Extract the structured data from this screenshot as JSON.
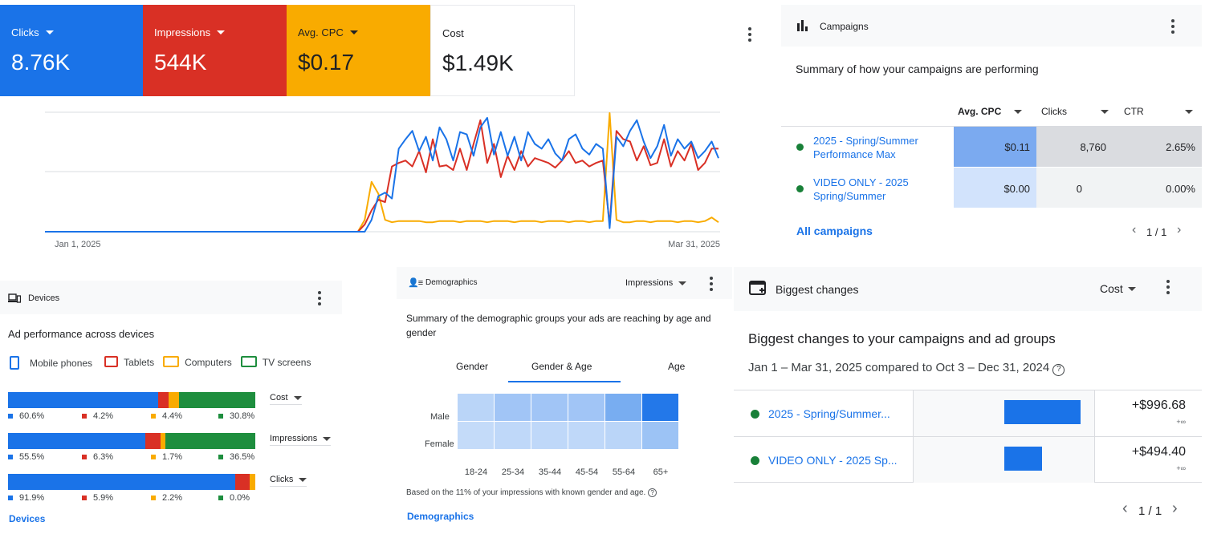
{
  "colors": {
    "blue": "#1a73e8",
    "red": "#d93025",
    "yellow": "#f9ab00",
    "green": "#1e8e3e",
    "navy": "#1967d2"
  },
  "metrics": [
    {
      "label": "Clicks",
      "value": "8.76K",
      "color": "#1a73e8",
      "dropdown": true
    },
    {
      "label": "Impressions",
      "value": "544K",
      "color": "#d93025",
      "dropdown": true
    },
    {
      "label": "Avg. CPC",
      "value": "$0.17",
      "color": "#f9ab00",
      "dropdown": true
    },
    {
      "label": "Cost",
      "value": "$1.49K",
      "color": "#ffffff",
      "dropdown": false
    }
  ],
  "chart_data": {
    "type": "line",
    "x_start_label": "Jan 1, 2025",
    "x_end_label": "Mar 31, 2025",
    "series": [
      {
        "name": "Clicks",
        "color": "#1a73e8",
        "values": [
          0,
          0,
          0,
          0,
          0,
          0,
          0,
          0,
          0,
          0,
          0,
          0,
          0,
          0,
          0,
          0,
          0,
          0,
          0,
          0,
          0,
          0,
          0,
          0,
          0,
          0,
          0,
          0,
          0,
          0,
          0,
          0,
          0,
          0,
          0,
          0,
          0,
          0,
          0,
          0,
          0,
          0,
          0,
          0,
          0,
          0,
          0,
          0,
          0.1,
          0.3,
          0.33,
          0.28,
          0.7,
          0.78,
          0.85,
          0.68,
          0.8,
          0.6,
          0.88,
          0.78,
          0.6,
          0.84,
          0.82,
          0.64,
          0.88,
          0.96,
          0.65,
          0.84,
          0.64,
          0.8,
          0.6,
          0.84,
          0.74,
          0.7,
          0.78,
          0.66,
          0.6,
          0.78,
          0.82,
          0.7,
          0.65,
          0.74,
          0.7,
          0.03,
          0.8,
          0.72,
          0.85,
          0.94,
          0.76,
          0.62,
          0.72,
          0.9,
          0.64,
          0.78,
          0.7,
          0.76,
          0.62,
          0.68,
          0.76,
          0.62
        ]
      },
      {
        "name": "Impressions",
        "color": "#d93025",
        "values": [
          0,
          0,
          0,
          0,
          0,
          0,
          0,
          0,
          0,
          0,
          0,
          0,
          0,
          0,
          0,
          0,
          0,
          0,
          0,
          0,
          0,
          0,
          0,
          0,
          0,
          0,
          0,
          0,
          0,
          0,
          0,
          0,
          0,
          0,
          0,
          0,
          0,
          0,
          0,
          0,
          0,
          0,
          0,
          0,
          0,
          0,
          0,
          0.06,
          0.18,
          0.27,
          0.25,
          0.55,
          0.58,
          0.6,
          0.55,
          0.68,
          0.5,
          0.78,
          0.55,
          0.56,
          0.52,
          0.7,
          0.52,
          0.74,
          0.94,
          0.58,
          0.74,
          0.46,
          0.64,
          0.52,
          0.68,
          0.55,
          0.62,
          0.6,
          0.58,
          0.54,
          0.6,
          0.68,
          0.58,
          0.6,
          0.55,
          0.58,
          0.6,
          0.06,
          0.85,
          0.78,
          0.76,
          0.6,
          0.72,
          0.56,
          0.58,
          0.78,
          0.55,
          0.68,
          0.6,
          0.74,
          0.52,
          0.58,
          0.7,
          0.7
        ]
      },
      {
        "name": "Avg. CPC",
        "color": "#f9ab00",
        "values": [
          0,
          0,
          0,
          0,
          0,
          0,
          0,
          0,
          0,
          0,
          0,
          0,
          0,
          0,
          0,
          0,
          0,
          0,
          0,
          0,
          0,
          0,
          0,
          0,
          0,
          0,
          0,
          0,
          0,
          0,
          0,
          0,
          0,
          0,
          0,
          0,
          0,
          0,
          0,
          0,
          0,
          0,
          0,
          0,
          0,
          0,
          0,
          0.1,
          0.42,
          0.32,
          0.1,
          0.08,
          0.09,
          0.09,
          0.09,
          0.09,
          0.08,
          0.08,
          0.09,
          0.09,
          0.09,
          0.08,
          0.09,
          0.09,
          0.09,
          0.08,
          0.09,
          0.09,
          0.09,
          0.08,
          0.09,
          0.09,
          0.09,
          0.08,
          0.09,
          0.09,
          0.09,
          0.08,
          0.09,
          0.09,
          0.08,
          0.09,
          0.09,
          1.0,
          0.1,
          0.08,
          0.08,
          0.09,
          0.09,
          0.08,
          0.09,
          0.09,
          0.09,
          0.08,
          0.09,
          0.09,
          0.08,
          0.09,
          0.12,
          0.08
        ]
      }
    ]
  },
  "campaigns": {
    "title": "Campaigns",
    "subtitle": "Summary of how your campaigns are performing",
    "columns": [
      "Avg. CPC",
      "Clicks",
      "CTR"
    ],
    "rows": [
      {
        "name": "2025 - Spring/Summer Performance Max",
        "cpc": "$0.11",
        "clicks": "8,760",
        "ctr": "2.65%"
      },
      {
        "name": "VIDEO ONLY - 2025 Spring/Summer",
        "cpc": "$0.00",
        "clicks": "0",
        "ctr": "0.00%"
      }
    ],
    "link": "All campaigns",
    "pager": "1 / 1"
  },
  "devices": {
    "title": "Devices",
    "subtitle": "Ad performance across devices",
    "legend": [
      {
        "label": "Mobile phones",
        "color": "#1a73e8"
      },
      {
        "label": "Tablets",
        "color": "#d93025"
      },
      {
        "label": "Computers",
        "color": "#f9ab00"
      },
      {
        "label": "TV screens",
        "color": "#1e8e3e"
      }
    ],
    "rows": [
      {
        "metric": "Cost",
        "values": [
          60.6,
          4.2,
          4.4,
          30.8
        ],
        "labels": [
          "60.6%",
          "4.2%",
          "4.4%",
          "30.8%"
        ]
      },
      {
        "metric": "Impressions",
        "values": [
          55.5,
          6.3,
          1.7,
          36.5
        ],
        "labels": [
          "55.5%",
          "6.3%",
          "1.7%",
          "36.5%"
        ]
      },
      {
        "metric": "Clicks",
        "values": [
          91.9,
          5.9,
          2.2,
          0.0
        ],
        "labels": [
          "91.9%",
          "5.9%",
          "2.2%",
          "0.0%"
        ]
      }
    ],
    "link": "Devices"
  },
  "demographics": {
    "title": "Demographics",
    "metric": "Impressions",
    "subtitle": "Summary of the demographic groups your ads are reaching by age and gender",
    "tabs": [
      "Gender",
      "Gender & Age",
      "Age"
    ],
    "active_tab": 1,
    "row_labels": [
      "Male",
      "Female"
    ],
    "age_labels": [
      "18-24",
      "25-34",
      "35-44",
      "45-54",
      "55-64",
      "65+"
    ],
    "heat": [
      [
        0.15,
        0.28,
        0.28,
        0.28,
        0.5,
        0.95
      ],
      [
        0.1,
        0.12,
        0.12,
        0.12,
        0.15,
        0.3
      ]
    ],
    "note": "Based on the 11% of your impressions with known gender and age.",
    "link": "Demographics"
  },
  "changes": {
    "title": "Biggest changes",
    "metric": "Cost",
    "subtitle": "Biggest changes to your campaigns and ad groups",
    "range": "Jan 1 – Mar 31, 2025 compared to Oct 3 – Dec 31, 2024",
    "rows": [
      {
        "name": "2025 - Spring/Summer...",
        "value": "+$996.68",
        "delta": "+∞",
        "amount": 996.68
      },
      {
        "name": "VIDEO ONLY - 2025 Sp...",
        "value": "+$494.40",
        "delta": "+∞",
        "amount": 494.4
      }
    ],
    "pager": "1 / 1"
  }
}
